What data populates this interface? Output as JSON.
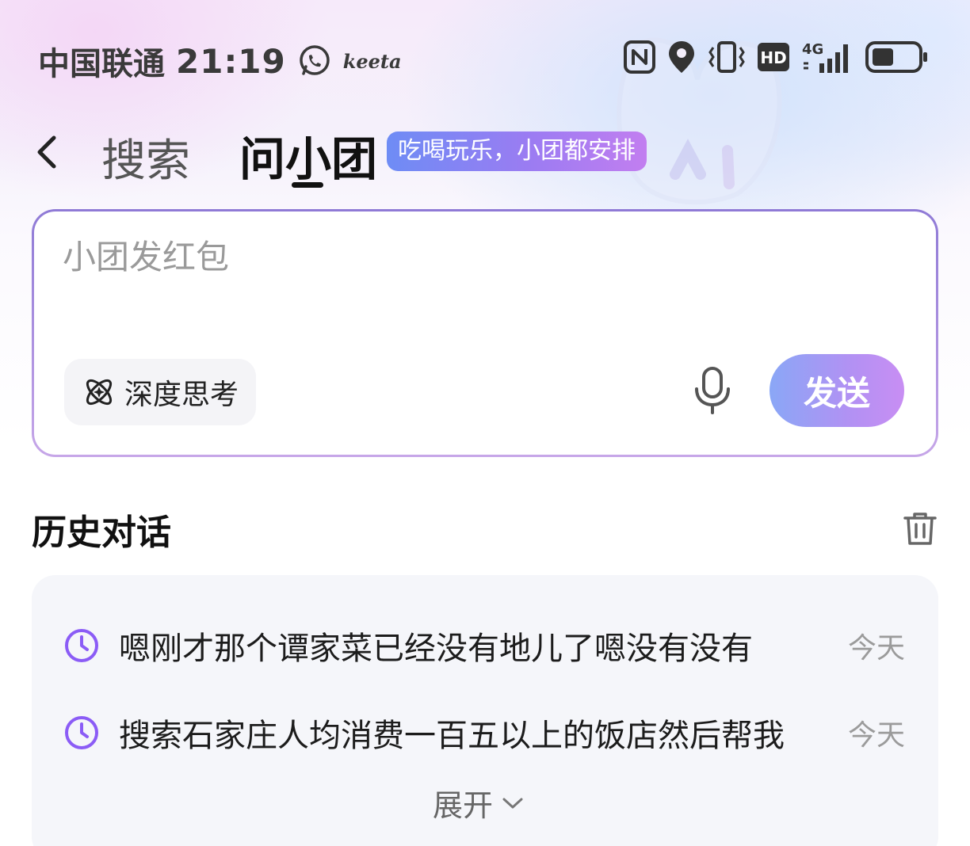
{
  "status_bar": {
    "carrier": "中国联通",
    "time": "21:19",
    "app_label": "keeta",
    "network": "4G",
    "hd": "HD"
  },
  "header": {
    "tab_search": "搜索",
    "tab_ask": "问小团",
    "tagline": "吃喝玩乐，小团都安排"
  },
  "input": {
    "placeholder": "小团发红包",
    "deep_think_label": "深度思考",
    "send_label": "发送"
  },
  "history": {
    "title": "历史对话",
    "items": [
      {
        "text": "嗯刚才那个谭家菜已经没有地儿了嗯没有没有",
        "date": "今天"
      },
      {
        "text": "搜索石家庄人均消费一百五以上的饭店然后帮我",
        "date": "今天"
      }
    ],
    "expand_label": "展开"
  },
  "colors": {
    "accent_purple": "#8b5cf6",
    "tag_gradient_start": "#6e8cf5",
    "tag_gradient_end": "#c27ef0",
    "send_gradient_start": "#8aa7f6",
    "send_gradient_end": "#c88ef3"
  },
  "icons": [
    "whatsapp-icon",
    "nfc-icon",
    "location-icon",
    "vibrate-icon",
    "hd-icon",
    "signal-icon",
    "battery-icon",
    "back-icon",
    "atom-icon",
    "mic-icon",
    "trash-icon",
    "clock-icon",
    "chevron-down-icon"
  ]
}
